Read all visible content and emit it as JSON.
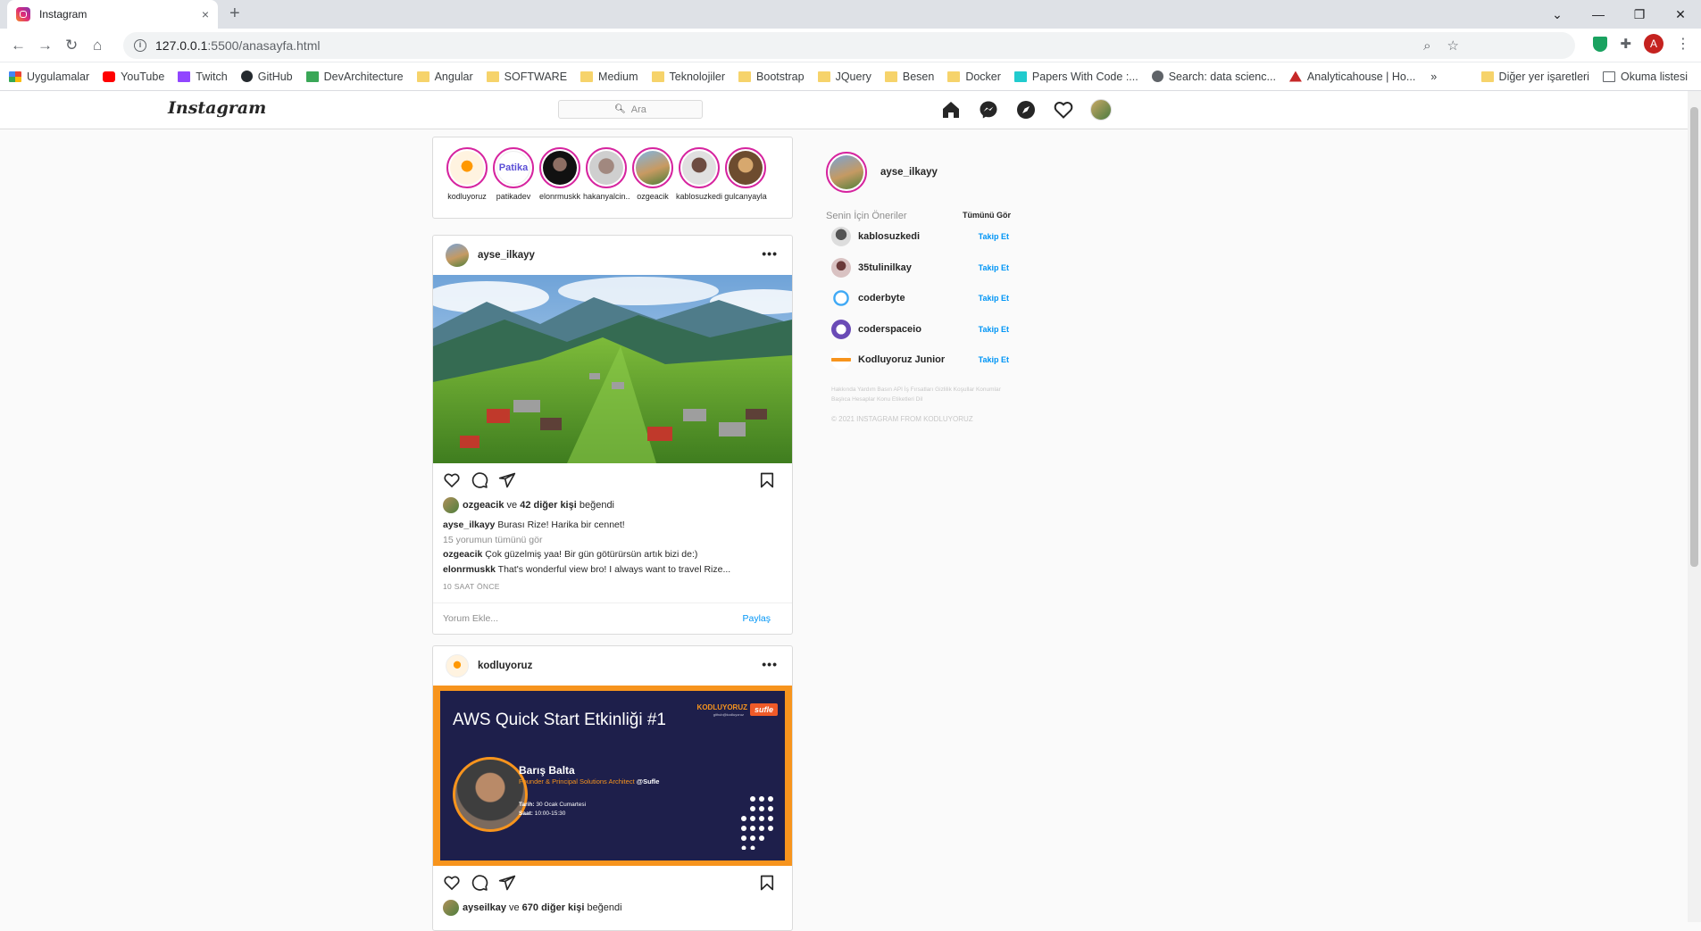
{
  "browser": {
    "tab_title": "Instagram",
    "tab_close": "×",
    "new_tab": "+",
    "url_host": "127.0.0.1",
    "url_rest": ":5500/anasayfa.html",
    "avatar_letter": "A",
    "bookmarks": [
      "Uygulamalar",
      "YouTube",
      "Twitch",
      "GitHub",
      "DevArchitecture",
      "Angular",
      "SOFTWARE",
      "Medium",
      "Teknolojiler",
      "Bootstrap",
      "JQuery",
      "Besen",
      "Docker",
      "Papers With Code :...",
      "Search: data scienc...",
      "Analyticahouse | Ho..."
    ],
    "more_bookmarks": "»",
    "other_bookmarks": "Diğer yer işaretleri",
    "reading_list": "Okuma listesi"
  },
  "instagram": {
    "logo": "Instagram",
    "search_placeholder": "Ara",
    "stories": [
      "kodluyoruz",
      "patikadev",
      "elonrmuskk",
      "hakanyalcin..",
      "ozgeacik",
      "kablosuzkedi",
      "gulcanyayla"
    ],
    "post1": {
      "username": "ayse_ilkayy",
      "menu": "•••",
      "likes_user": "ozgeacik",
      "likes_mid": " ve ",
      "likes_count": "42 diğer kişi",
      "likes_tail": " beğendi",
      "caption_user": "ayse_ilkayy",
      "caption": " Burası Rize! Harika bir cennet!",
      "view_all": "15 yorumun tümünü gör",
      "c1_user": "ozgeacik",
      "c1_text": " Çok güzelmiş yaa! Bir gün götürürsün artık bizi de:)",
      "c2_user": "elonrmuskk",
      "c2_text": " That's wonderful view bro! I always want to travel Rize...",
      "time": "10 SAAT ÖNCE",
      "comment_placeholder": "Yorum Ekle...",
      "share": "Paylaş"
    },
    "post2": {
      "username": "kodluyoruz",
      "menu": "•••",
      "banner_title": "AWS Quick Start Etkinliği #1",
      "banner_brand": "KODLUYORUZ",
      "banner_brand_sub": "github@kodluyoruz",
      "banner_partner": "sufle",
      "speaker": "Barış Balta",
      "speaker_role": "Founder & Principal Solutions Architect",
      "speaker_org": "@Sufle",
      "date_label": "Tarih:",
      "date_value": " 30 Ocak Cumartesi",
      "time_label": "Saat:",
      "time_value": " 10:00-15:30",
      "likes_user": "ayseilkay",
      "likes_mid": " ve ",
      "likes_count": "670 diğer kişi",
      "likes_tail": " beğendi"
    },
    "sidebar": {
      "username": "ayse_ilkayy",
      "suggestions_title": "Senin İçin Öneriler",
      "see_all": "Tümünü Gör",
      "suggestions": [
        {
          "name": "kablosuzkedi",
          "action": "Takip Et"
        },
        {
          "name": "35tulinilkay",
          "action": "Takip Et"
        },
        {
          "name": "coderbyte",
          "action": "Takip Et"
        },
        {
          "name": "coderspaceio",
          "action": "Takip Et"
        },
        {
          "name": "Kodluyoruz Junior",
          "action": "Takip Et"
        }
      ],
      "footer": "Hakkında Yardım Basın API İş Fırsatları Gizlilik Koşullar Konumlar Başlıca Hesaplar Konu Etiketleri Dil",
      "copyright": "© 2021 INSTAGRAM FROM KODLUYORUZ"
    }
  }
}
